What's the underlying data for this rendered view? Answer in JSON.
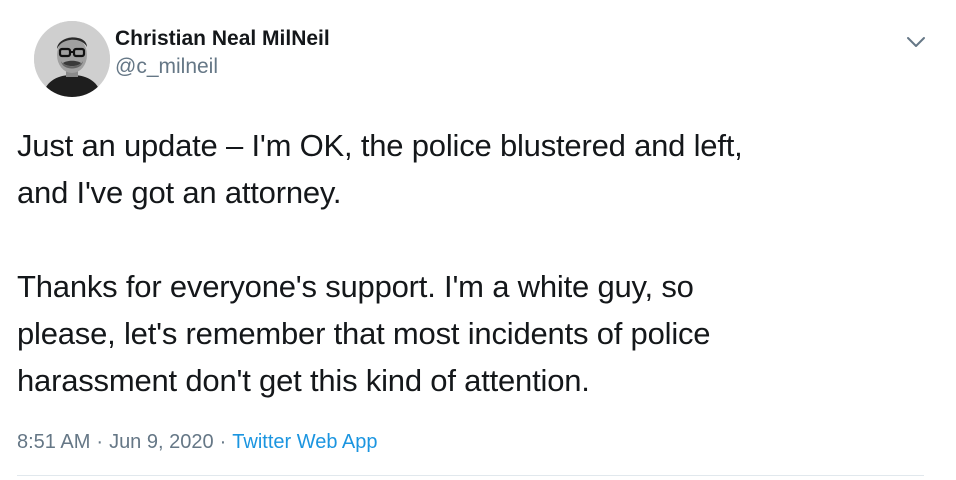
{
  "author": {
    "display_name": "Christian Neal MilNeil",
    "handle": "@c_milneil",
    "avatar_icon": "profile-photo"
  },
  "tweet": {
    "text": "Just an update – I'm OK, the police blustered and left,\nand I've got an attorney.\n\nThanks for everyone's support. I'm a white guy, so\nplease, let's remember that most incidents of police\nharassment don't get this kind of attention."
  },
  "meta": {
    "time": "8:51 AM",
    "separator": "·",
    "date": "Jun 9, 2020",
    "source": "Twitter Web App"
  },
  "menu": {
    "icon": "chevron-down-icon"
  },
  "colors": {
    "text_primary": "#14171a",
    "text_secondary": "#657786",
    "link": "#1b95e0",
    "divider": "#e1e8ed",
    "background": "#ffffff"
  }
}
